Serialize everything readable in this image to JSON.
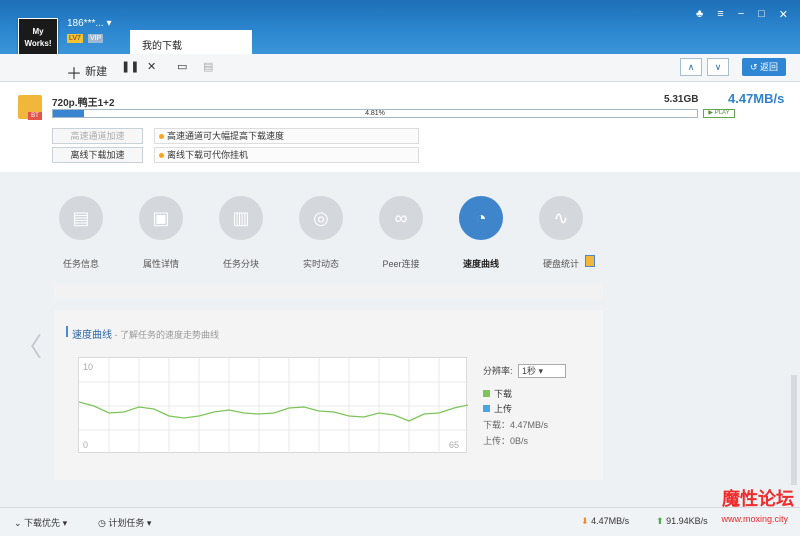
{
  "header": {
    "username": "186***...",
    "level": "LV7",
    "vip": "VIP",
    "tab_label": "我的下载"
  },
  "toolbar": {
    "new_label": "新建",
    "back_label": "返回"
  },
  "task": {
    "file_name": "720p.鸭王1+2",
    "file_type": "BT",
    "size": "5.31GB",
    "speed": "4.47MB/s",
    "progress_percent": 4.81,
    "progress_label": "4.81%",
    "play_label": "PLAY",
    "button1": "高速通道加速",
    "button2": "离线下载加速",
    "hint1": "高速通道可大幅提高下载速度",
    "hint2": "离线下载可代你挂机"
  },
  "nav": {
    "items": [
      "任务信息",
      "属性详情",
      "任务分块",
      "实时动态",
      "Peer连接",
      "速度曲线",
      "硬盘统计"
    ]
  },
  "speed_panel": {
    "title": "速度曲线",
    "subtitle": " - 了解任务的速度走势曲线",
    "rate_label": "分辨率:",
    "rate_value": "1秒",
    "legend_download": "下载",
    "legend_upload": "上传",
    "download_value": "下载：4.47MB/s",
    "upload_value": "上传：0B/s",
    "y_max": "10",
    "y_min": "0",
    "x_max": "65"
  },
  "bottom": {
    "download_priority": "下载优先",
    "scheduled": "计划任务",
    "down_speed": "4.47MB/s",
    "up_speed": "91.94KB/s"
  },
  "watermark": {
    "text": "魔性论坛",
    "url": "www.moxing.city"
  },
  "colors": {
    "accent": "#2f82cf",
    "download_line": "#7fc45a",
    "upload": "#4ea4e0"
  }
}
